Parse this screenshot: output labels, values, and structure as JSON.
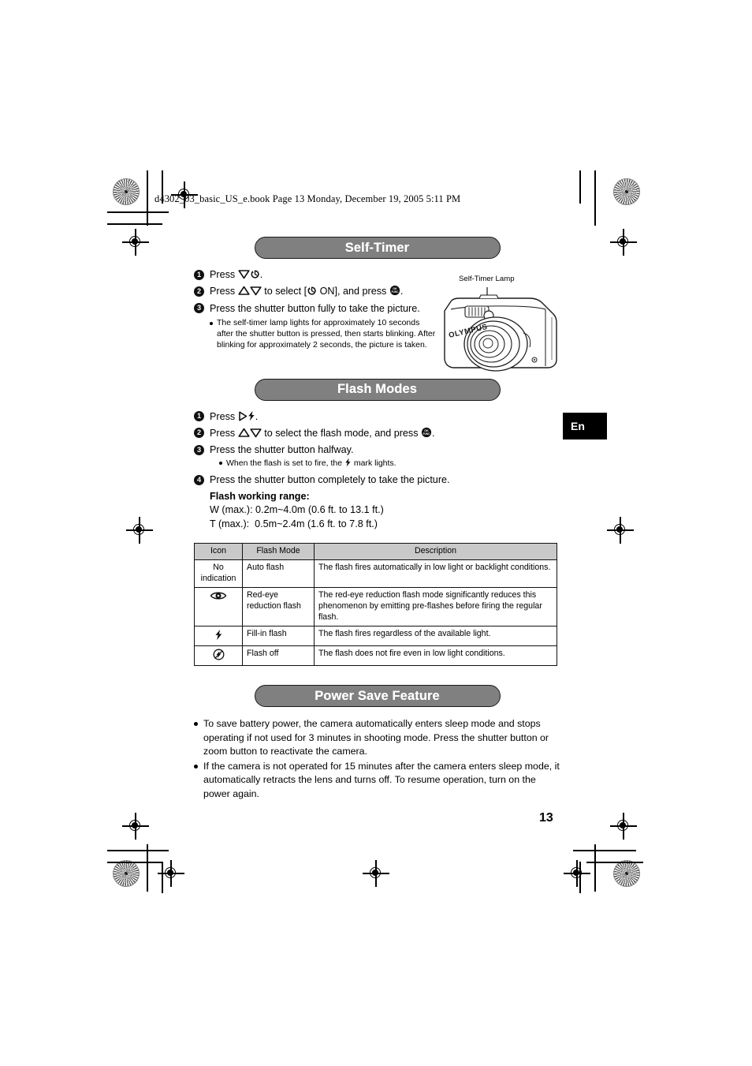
{
  "print_header": {
    "file_line": "d4302_03_basic_US_e.book  Page 13  Monday, December 19, 2005  5:11 PM"
  },
  "language_tab": {
    "label": "En"
  },
  "page_number": "13",
  "sections": [
    {
      "id": "self-timer",
      "title": "Self-Timer",
      "steps": [
        {
          "num": "1",
          "pre": "Press ",
          "icons": [
            "down-arrow-icon",
            "self-timer-icon"
          ],
          "post": "."
        },
        {
          "num": "2",
          "pre": "Press ",
          "icons": [
            "up-arrow-icon",
            "down-arrow-icon"
          ],
          "mid": " to select [",
          "icons2": [
            "self-timer-icon"
          ],
          "mid2": " ON], and press ",
          "icons3": [
            "ok-func-icon"
          ],
          "post": "."
        },
        {
          "num": "3",
          "pre": "Press the shutter button fully to take the picture.",
          "icons": [],
          "post": ""
        }
      ],
      "subbullets": [
        "The self-timer lamp lights for approximately 10 seconds after the shutter button is pressed, then starts blinking. After blinking for approximately 2 seconds, the picture is taken."
      ]
    },
    {
      "id": "flash-modes",
      "title": "Flash Modes",
      "steps": [
        {
          "num": "1",
          "pre": "Press ",
          "icons": [
            "right-arrow-icon",
            "flash-bolt-icon"
          ],
          "post": "."
        },
        {
          "num": "2",
          "pre": "Press ",
          "icons": [
            "up-arrow-icon",
            "down-arrow-icon"
          ],
          "mid": " to select the flash mode, and press ",
          "icons3": [
            "ok-func-icon"
          ],
          "post": "."
        },
        {
          "num": "3",
          "pre": "Press the shutter button halfway.",
          "icons": [],
          "post": ""
        },
        {
          "num": "4",
          "pre": "Press the shutter button completely to take the picture.",
          "icons": [],
          "post": ""
        }
      ],
      "step3_subbullet_pre": "When the flash is set to fire, the ",
      "step3_subbullet_post": " mark lights.",
      "range": {
        "title": "Flash working range:",
        "rows": [
          "W (max.): 0.2m~4.0m (0.6 ft. to 13.1 ft.)",
          "T (max.):  0.5m~2.4m (1.6 ft. to 7.8 ft.)"
        ]
      }
    },
    {
      "id": "power-save-feature",
      "title": "Power Save Feature",
      "bullets": [
        "To save battery power, the camera automatically enters sleep mode and stops operating if not used for 3 minutes in shooting mode. Press the shutter button or zoom button to reactivate the camera.",
        "If the camera is not operated for 15 minutes after the camera enters sleep mode, it automatically retracts the lens and turns off. To resume operation, turn on the power again."
      ]
    }
  ],
  "figure": {
    "label": "Self-Timer Lamp",
    "brand": "OLYMPUS"
  },
  "flash_table": {
    "headers": [
      "Icon",
      "Flash Mode",
      "Description"
    ],
    "rows": [
      {
        "icon_kind": "text",
        "icon_text": "No indication",
        "mode": "Auto flash",
        "description": "The flash fires automatically in low light or backlight conditions."
      },
      {
        "icon_kind": "red-eye-icon",
        "icon_text": "",
        "mode": "Red-eye reduction flash",
        "description": "The red-eye reduction flash mode significantly reduces this phenomenon by emitting pre-flashes before firing the regular flash."
      },
      {
        "icon_kind": "flash-bolt-icon",
        "icon_text": "",
        "mode": "Fill-in flash",
        "description": "The flash fires regardless of the available light."
      },
      {
        "icon_kind": "flash-off-icon",
        "icon_text": "",
        "mode": "Flash off",
        "description": "The flash does not fire even in low light conditions."
      }
    ]
  },
  "colors": {
    "banner_fill": "#808080",
    "banner_text": "#ffffff",
    "table_header_fill": "#c9c9c9",
    "tab_fill": "#000000"
  }
}
